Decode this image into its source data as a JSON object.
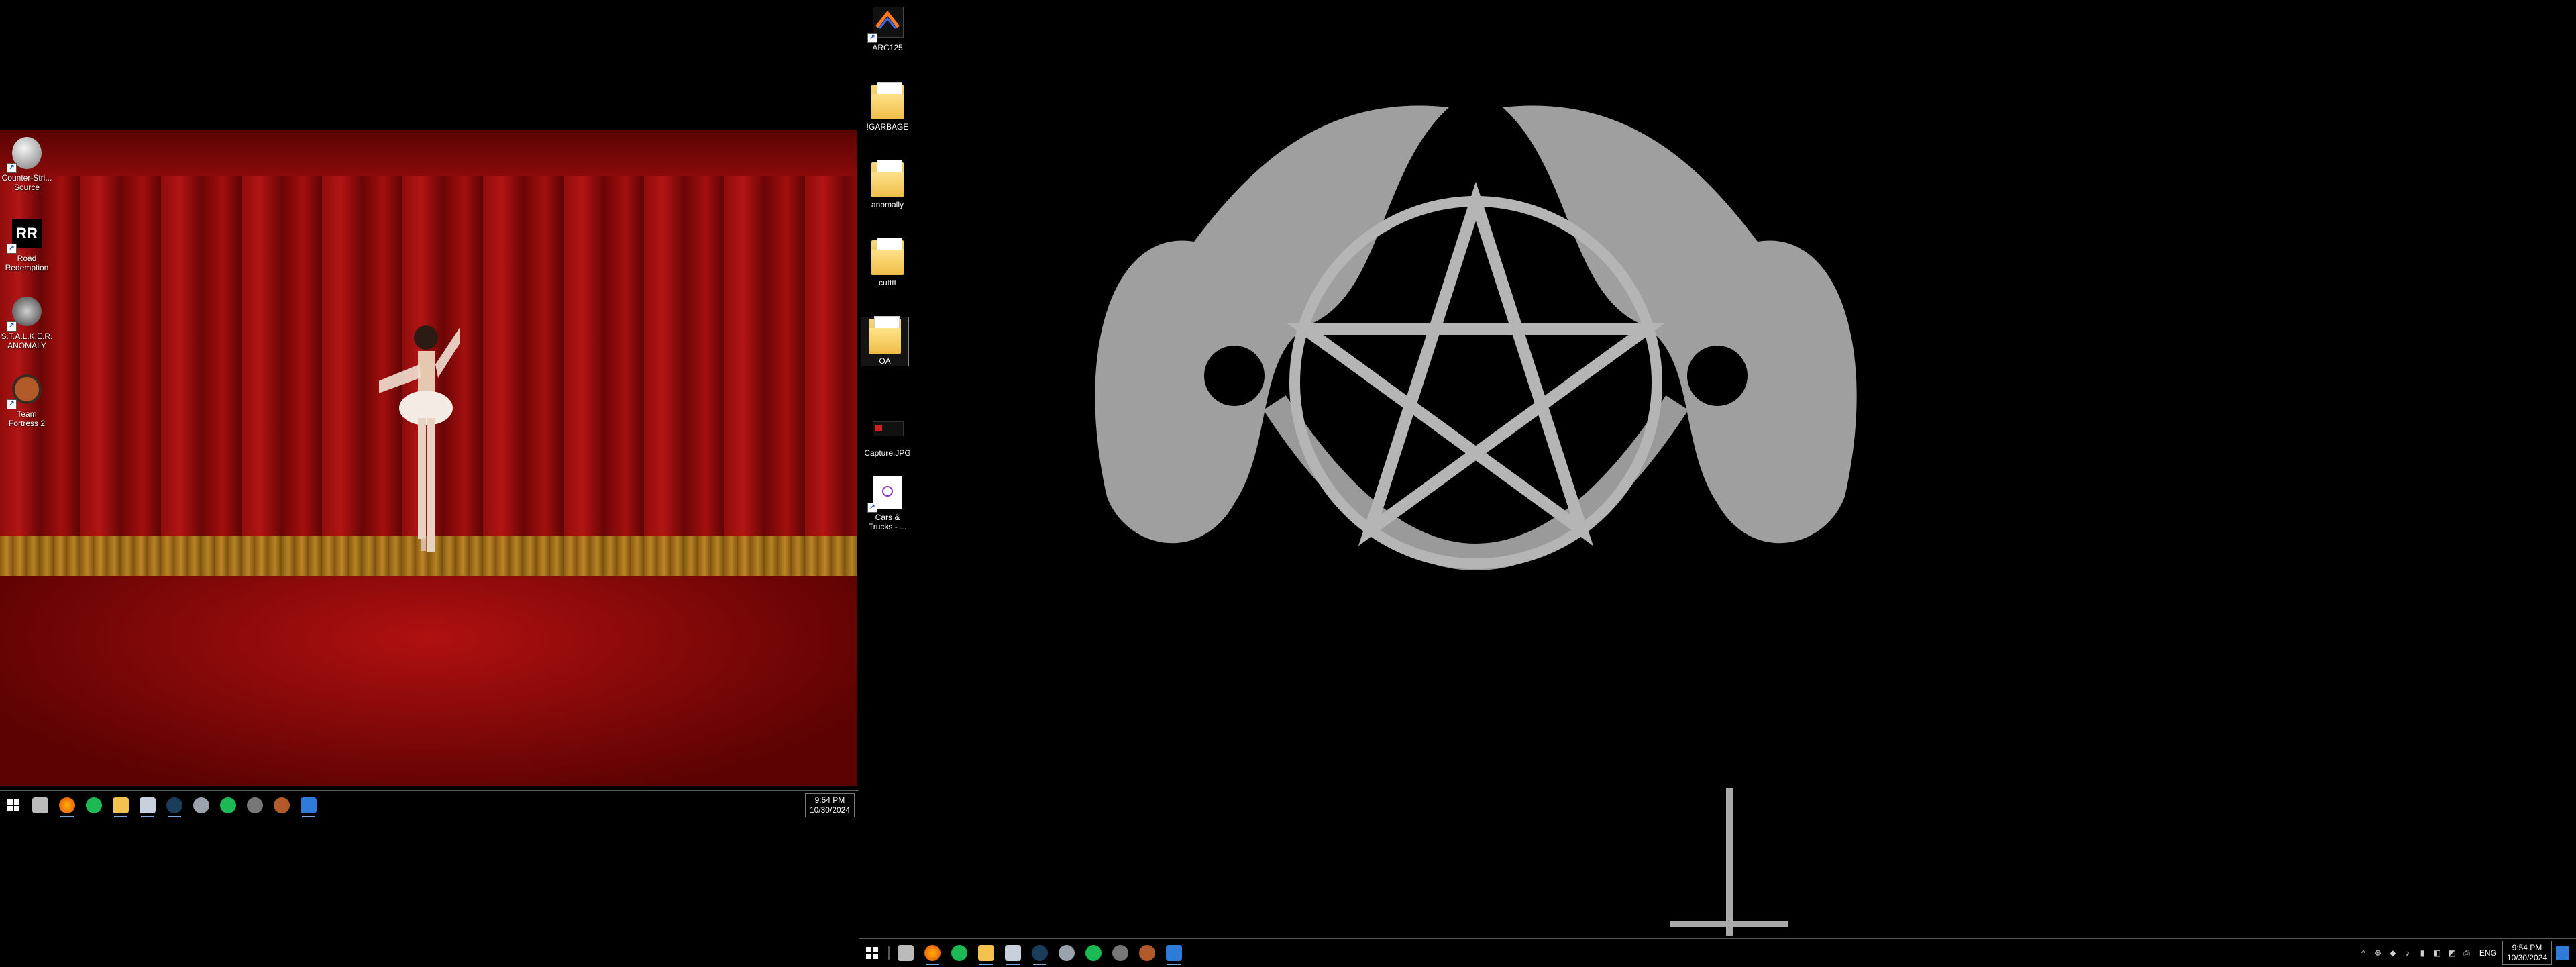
{
  "left_monitor": {
    "desktop_icons": [
      {
        "label": "Counter-Stri...\nSource",
        "icon": "counter-strike-icon",
        "color": "#c9c9c9"
      },
      {
        "label": "Road\nRedemption",
        "icon": "road-redemption-icon",
        "color": "#ffffff"
      },
      {
        "label": "S.T.A.L.K.E.R.\nANOMALY",
        "icon": "stalker-anomaly-icon",
        "color": "#8a8a8a"
      },
      {
        "label": "Team\nFortress 2",
        "icon": "tf2-icon",
        "color": "#b35a2a"
      }
    ],
    "taskbar": {
      "apps": [
        "start-icon",
        "file-explorer-drive-icon",
        "firefox-icon",
        "spotify-icon",
        "folder-icon",
        "steam-cloud-icon",
        "steam-icon",
        "game-controller-icon",
        "spotify-icon",
        "anomaly-icon",
        "tf2-icon",
        "editor-icon"
      ],
      "time": "9:54 PM",
      "date": "10/30/2024"
    }
  },
  "right_monitor": {
    "desktop_icons": [
      {
        "label": "ARC125",
        "icon": "arc-icon"
      },
      {
        "label": "!GARBAGE",
        "icon": "folder-icon"
      },
      {
        "label": "anomally",
        "icon": "folder-icon"
      },
      {
        "label": "cutttt",
        "icon": "folder-icon"
      },
      {
        "label": "OA",
        "icon": "folder-icon",
        "selected": true
      },
      {
        "label": "Capture.JPG",
        "icon": "image-file-icon"
      },
      {
        "label": "Cars &\nTrucks - ...",
        "icon": "shortcut-file-icon"
      }
    ],
    "taskbar": {
      "apps": [
        "start-icon",
        "file-explorer-drive-icon",
        "firefox-icon",
        "spotify-icon",
        "folder-icon",
        "steam-cloud-icon",
        "steam-icon",
        "game-controller-icon",
        "spotify-icon",
        "anomaly-icon",
        "tf2-icon",
        "editor-icon"
      ],
      "tray": [
        "^",
        "⚙",
        "◆",
        "♪",
        "▮",
        "◧",
        "◩",
        "⎙"
      ],
      "language": "ENG",
      "time": "9:54 PM",
      "date": "10/30/2024"
    }
  }
}
